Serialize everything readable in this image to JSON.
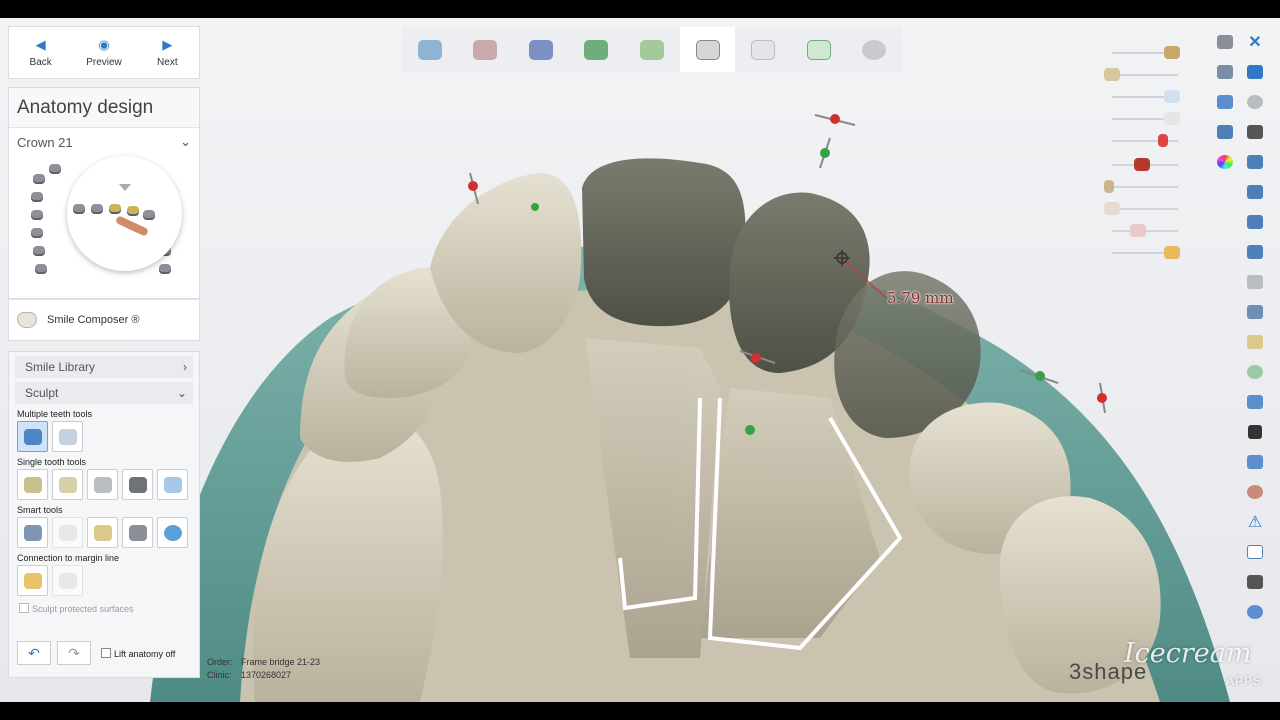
{
  "nav": {
    "back": "Back",
    "preview": "Preview",
    "next": "Next"
  },
  "anatomy": {
    "title": "Anatomy design",
    "crown": "Crown 21"
  },
  "smile_composer": "Smile Composer ®",
  "sections": {
    "library": "Smile Library",
    "sculpt": "Sculpt"
  },
  "groups": {
    "multiple": "Multiple teeth tools",
    "single": "Single tooth tools",
    "smart": "Smart tools",
    "margin": "Connection to margin line"
  },
  "protected_label": "Sculpt protected surfaces",
  "lift_label": "Lift anatomy off",
  "measurement": "5.79 mm",
  "order": {
    "order_key": "Order:",
    "order_value": "Frame bridge 21-23",
    "clinic_key": "Clinic:",
    "clinic_value": "1370268027"
  },
  "logo": "3shape",
  "watermark": {
    "main": "Icecream",
    "sub": "APPS"
  },
  "workflow_icons": [
    "brush-icon",
    "cut-icon",
    "bridge-icon",
    "download-icon",
    "margin-icon",
    "crown-icon",
    "crown-outline-icon",
    "crown-check-icon",
    "disc-icon"
  ],
  "colors": {
    "accent": "#2f78c4",
    "gingiva": "#6aa39d",
    "tooth": "#d6d0bd",
    "crown": "#5e5f52",
    "marker_red": "#d23030",
    "marker_green": "#3aa142"
  }
}
